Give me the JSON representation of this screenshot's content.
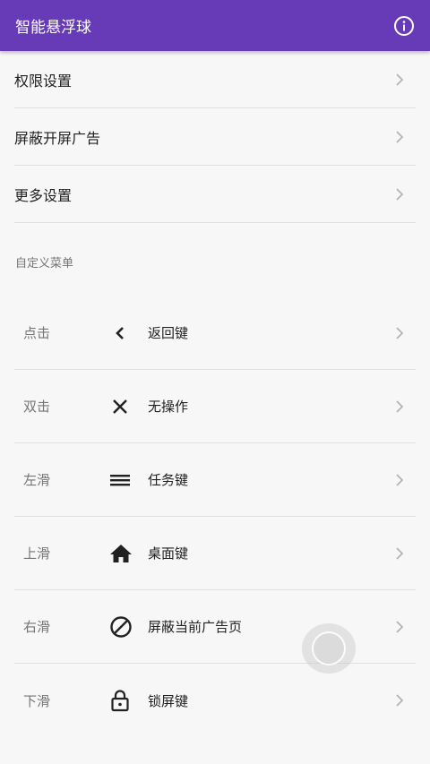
{
  "appbar": {
    "title": "智能悬浮球",
    "info_icon": "info-circle-icon",
    "background": "#673ab7"
  },
  "settings": [
    {
      "label": "权限设置"
    },
    {
      "label": "屏蔽开屏广告"
    },
    {
      "label": "更多设置"
    }
  ],
  "custom_menu": {
    "header": "自定义菜单",
    "items": [
      {
        "gesture": "点击",
        "icon": "back-arrow-icon",
        "action": "返回键"
      },
      {
        "gesture": "双击",
        "icon": "close-icon",
        "action": "无操作"
      },
      {
        "gesture": "左滑",
        "icon": "menu-icon",
        "action": "任务键"
      },
      {
        "gesture": "上滑",
        "icon": "home-icon",
        "action": "桌面键"
      },
      {
        "gesture": "右滑",
        "icon": "block-icon",
        "action": "屏蔽当前广告页"
      },
      {
        "gesture": "下滑",
        "icon": "lock-icon",
        "action": "锁屏键"
      }
    ]
  }
}
